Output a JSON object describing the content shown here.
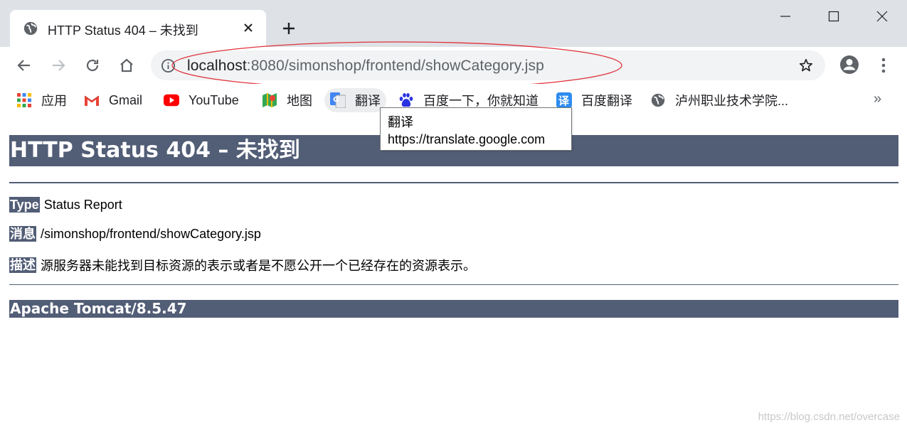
{
  "tab": {
    "title": "HTTP Status 404 – 未找到",
    "favicon": "globe-icon",
    "close": "close-icon"
  },
  "window": {
    "new_tab": "plus-icon",
    "minimize": "minimize-icon",
    "maximize": "maximize-icon",
    "close": "close-icon"
  },
  "toolbar": {
    "back": "arrow-left-icon",
    "forward": "arrow-right-icon",
    "reload": "reload-icon",
    "home": "home-icon",
    "site_info": "info-icon",
    "url_host": "localhost",
    "url_path": ":8080/simonshop/frontend/showCategory.jsp",
    "bookmark_star": "star-icon",
    "profile": "account-icon",
    "menu": "more-vert-icon",
    "annotation_color": "#e0313a"
  },
  "bookmarks": {
    "items": [
      {
        "label": "应用",
        "icon": "apps-grid-icon"
      },
      {
        "label": "Gmail",
        "icon": "gmail-icon"
      },
      {
        "label": "YouTube",
        "icon": "youtube-icon"
      },
      {
        "label": "地图",
        "icon": "maps-icon"
      },
      {
        "label": "翻译",
        "icon": "google-translate-icon"
      },
      {
        "label": "百度一下，你就知道",
        "icon": "baidu-icon"
      },
      {
        "label": "百度翻译",
        "icon": "baidu-translate-icon"
      },
      {
        "label": "泸州职业技术学院...",
        "icon": "globe-icon"
      }
    ],
    "more": "»"
  },
  "tooltip": {
    "title": "翻译",
    "url": "https://translate.google.com"
  },
  "page": {
    "heading": "HTTP Status 404 – 未找到",
    "type_label": "Type",
    "type_value": "Status Report",
    "message_label": "消息",
    "message_value": "/simonshop/frontend/showCategory.jsp",
    "description_label": "描述",
    "description_value": "源服务器未能找到目标资源的表示或者是不愿公开一个已经存在的资源表示。",
    "footer": "Apache Tomcat/8.5.47",
    "accent_color": "#525d76"
  },
  "watermark": "https://blog.csdn.net/overcase"
}
